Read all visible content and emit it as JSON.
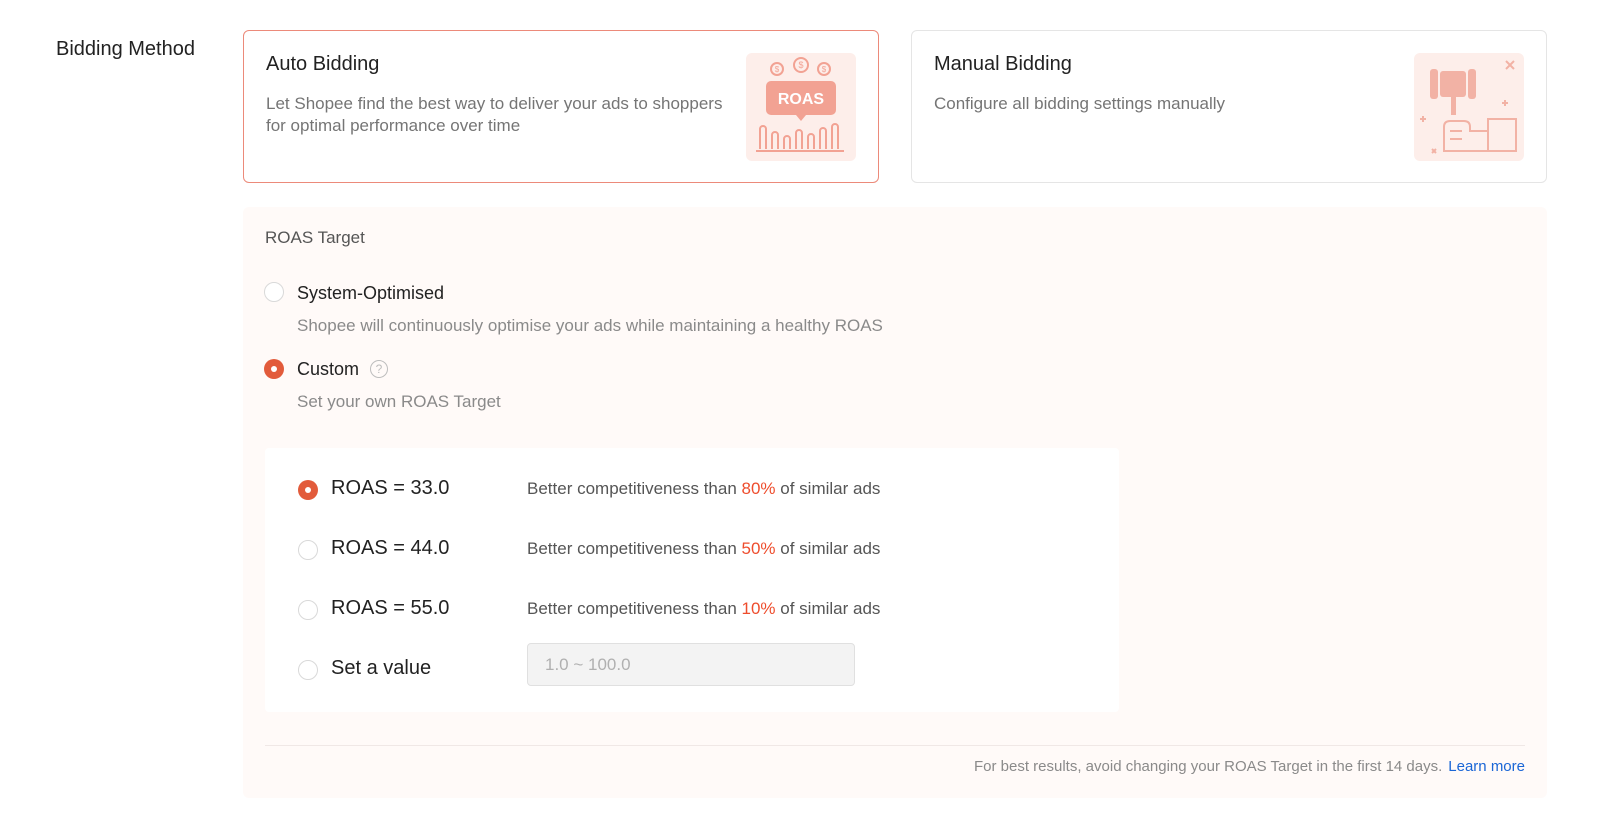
{
  "bidding": {
    "section_label": "Bidding Method",
    "auto": {
      "title": "Auto Bidding",
      "description": "Let Shopee find the best way to deliver your ads to shoppers for optimal performance over time",
      "illustration_text": "ROAS",
      "selected": true
    },
    "manual": {
      "title": "Manual Bidding",
      "description": "Configure all bidding settings manually",
      "selected": false
    }
  },
  "roas_target": {
    "title": "ROAS Target",
    "system_optimised": {
      "label": "System-Optimised",
      "description": "Shopee will continuously optimise your ads while maintaining a healthy ROAS",
      "checked": false
    },
    "custom": {
      "label": "Custom",
      "help_glyph": "?",
      "description": "Set your own ROAS Target",
      "checked": true
    },
    "options": [
      {
        "label": "ROAS = 33.0",
        "prefix": "Better competitiveness than",
        "percent": "80%",
        "suffix": "of similar ads",
        "checked": true
      },
      {
        "label": "ROAS = 44.0",
        "prefix": "Better competitiveness than",
        "percent": "50%",
        "suffix": "of similar ads",
        "checked": false
      },
      {
        "label": "ROAS = 55.0",
        "prefix": "Better competitiveness than",
        "percent": "10%",
        "suffix": "of similar ads",
        "checked": false
      }
    ],
    "set_value": {
      "label": "Set a value",
      "placeholder": "1.0 ~ 100.0",
      "checked": false
    },
    "footnote": "For best results, avoid changing your ROAS Target in the first 14 days.",
    "learn_more": "Learn more"
  },
  "colors": {
    "accent": "#ee4d2d",
    "link": "#1a66d6",
    "panel_bg": "#fffaf8"
  }
}
